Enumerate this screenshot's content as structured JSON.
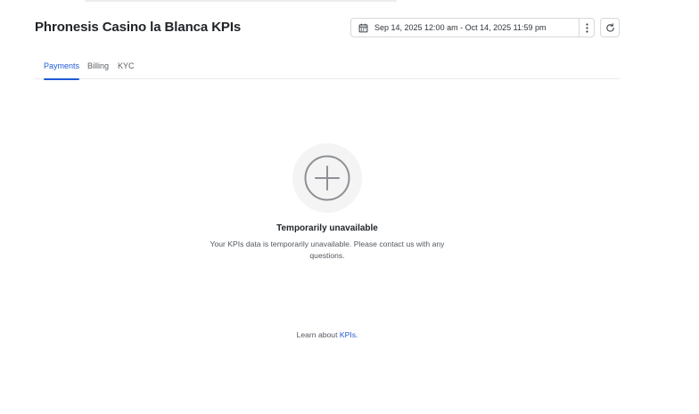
{
  "header": {
    "title": "Phronesis Casino la Blanca KPIs",
    "date_range": "Sep 14, 2025 12:00 am - Oct 14, 2025 11:59 pm",
    "icons": {
      "calendar": "calendar-icon",
      "more": "vertical-dots-icon",
      "refresh": "refresh-icon"
    }
  },
  "tabs": [
    {
      "label": "Payments",
      "active": true
    },
    {
      "label": "Billing",
      "active": false
    },
    {
      "label": "KYC",
      "active": false
    }
  ],
  "empty_state": {
    "icon": "add-circle-icon",
    "title": "Temporarily unavailable",
    "description": "Your KPIs data is temporarily unavailable. Please contact us with any questions."
  },
  "footer": {
    "learn_prefix": "Learn about ",
    "learn_link": "KPIs."
  },
  "colors": {
    "accent": "#1f5bd6",
    "text": "#1f2328",
    "muted": "#53585e",
    "border": "#d5d8dc"
  }
}
